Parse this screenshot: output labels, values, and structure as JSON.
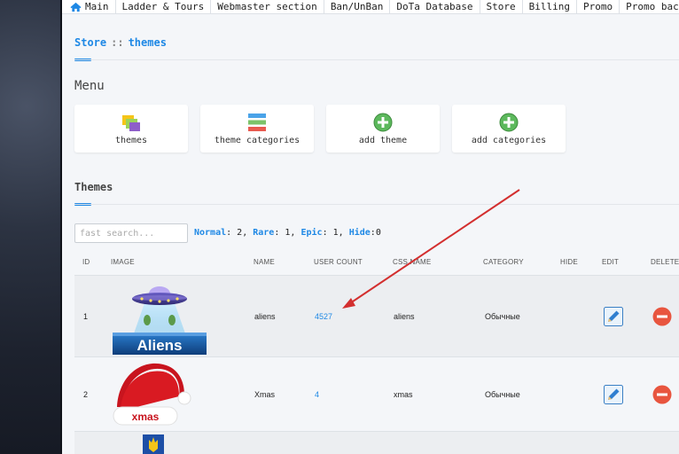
{
  "nav": {
    "items": [
      "Main",
      "Ladder & Tours",
      "Webmaster section",
      "Ban/UnBan",
      "DoTa Database",
      "Store",
      "Billing",
      "Promo",
      "Promo background"
    ]
  },
  "breadcrumb": {
    "root": "Store",
    "separator": "::",
    "current": "themes"
  },
  "menu": {
    "title": "Menu",
    "cards": [
      "themes",
      "theme categories",
      "add theme",
      "add categories"
    ]
  },
  "themes_section": {
    "title": "Themes",
    "search_placeholder": "fast search...",
    "counts": {
      "normal_label": "Normal",
      "normal_value": "2",
      "rare_label": "Rare",
      "rare_value": "1",
      "epic_label": "Epic",
      "epic_value": "1",
      "hide_label": "Hide",
      "hide_value": "0"
    }
  },
  "table": {
    "headers": [
      "ID",
      "IMAGE",
      "NAME",
      "USER COUNT",
      "CSS NAME",
      "CATEGORY",
      "HIDE",
      "EDIT",
      "DELETE"
    ],
    "rows": [
      {
        "id": "1",
        "image_text": "Aliens",
        "name": "aliens",
        "user_count": "4527",
        "css_name": "aliens",
        "category": "Обычные"
      },
      {
        "id": "2",
        "image_text": "xmas",
        "name": "Xmas",
        "user_count": "4",
        "css_name": "xmas",
        "category": "Обычные"
      }
    ]
  },
  "colors": {
    "accent": "#1e88e5",
    "annotation_arrow": "#d32f2f",
    "delete": "#e8553f"
  }
}
